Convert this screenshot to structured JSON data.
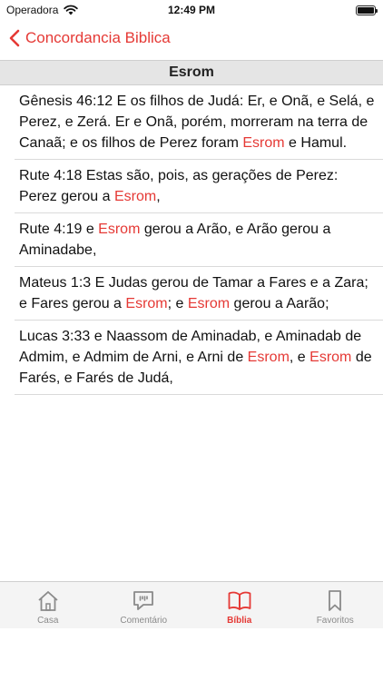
{
  "status_bar": {
    "carrier": "Operadora",
    "time": "12:49 PM",
    "battery_level": 1.0
  },
  "nav": {
    "back_label": "Concordancia Biblica"
  },
  "section_title": "Esrom",
  "colors": {
    "accent": "#e53935",
    "inactive": "#8a8a8a"
  },
  "verses": [
    {
      "segments": [
        {
          "text": "Gênesis 46:12 E os filhos de Judá: Er, e Onã, e Selá, e Perez, e Zerá. Er e Onã, porém, morreram na terra de Canaã; e os filhos de Perez foram ",
          "hl": false
        },
        {
          "text": "Esrom",
          "hl": true
        },
        {
          "text": " e Hamul.",
          "hl": false
        }
      ]
    },
    {
      "segments": [
        {
          "text": "Rute 4:18 Estas são, pois, as gerações de Perez: Perez gerou a ",
          "hl": false
        },
        {
          "text": "Esrom",
          "hl": true
        },
        {
          "text": ",",
          "hl": false
        }
      ]
    },
    {
      "segments": [
        {
          "text": "Rute 4:19 e ",
          "hl": false
        },
        {
          "text": "Esrom",
          "hl": true
        },
        {
          "text": " gerou a Arão, e Arão gerou a Aminadabe,",
          "hl": false
        }
      ]
    },
    {
      "segments": [
        {
          "text": "Mateus 1:3 E Judas gerou de Tamar a Fares e a Zara; e Fares gerou a ",
          "hl": false
        },
        {
          "text": "Esrom",
          "hl": true
        },
        {
          "text": "; e ",
          "hl": false
        },
        {
          "text": "Esrom",
          "hl": true
        },
        {
          "text": " gerou a Aarão;",
          "hl": false
        }
      ]
    },
    {
      "segments": [
        {
          "text": "Lucas 3:33 e Naassom de Aminadab, e Aminadab de Admim, e Admim de Arni, e Arni de ",
          "hl": false
        },
        {
          "text": "Esrom",
          "hl": true
        },
        {
          "text": ", e ",
          "hl": false
        },
        {
          "text": "Esrom",
          "hl": true
        },
        {
          "text": " de Farés, e Farés de Judá,",
          "hl": false
        }
      ]
    }
  ],
  "tabs": [
    {
      "label": "Casa",
      "icon": "house-icon",
      "active": false
    },
    {
      "label": "Comentário",
      "icon": "comment-bubble-icon",
      "active": false
    },
    {
      "label": "Bíblia",
      "icon": "open-book-icon",
      "active": true
    },
    {
      "label": "Favoritos",
      "icon": "bookmark-icon",
      "active": false
    }
  ]
}
